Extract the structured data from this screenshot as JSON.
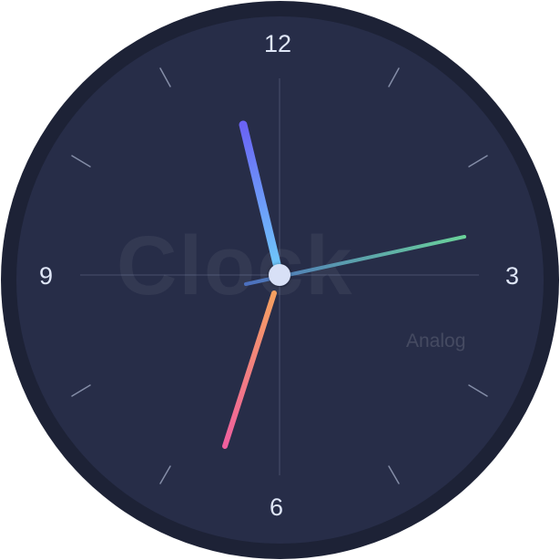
{
  "clock": {
    "numerals": {
      "n12": "12",
      "n3": "3",
      "n6": "6",
      "n9": "9"
    },
    "watermark": "Clock",
    "sublabel": "Analog",
    "time_shown": {
      "hour": 11,
      "minute": 33,
      "second": 13
    },
    "colors": {
      "rim": "#1d2236",
      "face": "#272d48",
      "numeral": "#dfe6f7",
      "hour_hand_gradient": [
        "#6a63f5",
        "#6fc6fb"
      ],
      "minute_hand_gradient": [
        "#f5a060",
        "#ef5f9f"
      ],
      "second_hand_gradient": [
        "#4c6fbf",
        "#6ad29a"
      ],
      "center_cap": "#d8e0f6"
    }
  }
}
